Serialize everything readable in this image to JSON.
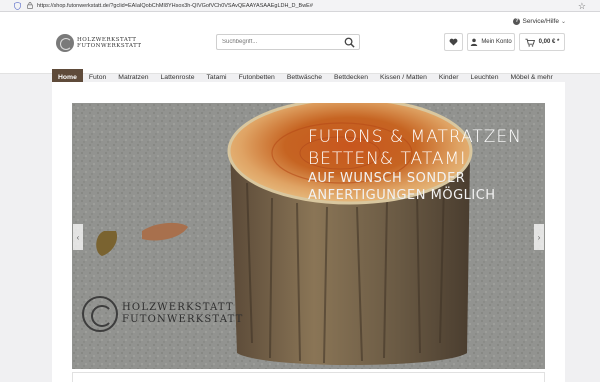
{
  "browser": {
    "url": "https://shop.futonwerkstatt.de/?gclid=EAIaIQobChMI8YHsox3h-QIVGofVCh0VSAvQEAAYASAAEgLDH_D_BwE#"
  },
  "header": {
    "service_label": "Service/Hilfe",
    "logo_line1": "HOLZWERKSTATT",
    "logo_line2": "FUTONWERKSTATT",
    "search_placeholder": "Suchbegriff...",
    "account_label": "Mein Konto",
    "cart_total": "0,00 € *"
  },
  "nav": {
    "items": [
      {
        "label": "Home",
        "active": true
      },
      {
        "label": "Futon"
      },
      {
        "label": "Matratzen"
      },
      {
        "label": "Lattenroste"
      },
      {
        "label": "Tatami"
      },
      {
        "label": "Futonbetten"
      },
      {
        "label": "Bettwäsche"
      },
      {
        "label": "Bettdecken"
      },
      {
        "label": "Kissen / Matten"
      },
      {
        "label": "Kinder"
      },
      {
        "label": "Leuchten"
      },
      {
        "label": "Möbel & mehr"
      }
    ]
  },
  "hero": {
    "line1": "FUTONS & MATRATZEN",
    "line2": "BETTEN& TATAMI",
    "line3": "AUF WUNSCH SONDER",
    "line4": "ANFERTIGUNGEN MÖGLICH",
    "logo_line1": "HOLZWERKSTATT",
    "logo_line2": "FUTONWERKSTATT",
    "prev_arrow": "‹",
    "next_arrow": "›"
  },
  "icons": {
    "shield": "shield-icon",
    "lock": "lock-icon",
    "star": "bookmark-star-icon",
    "help": "help-icon",
    "search": "search-icon",
    "heart": "heart-icon",
    "user": "user-icon",
    "cart": "cart-icon"
  },
  "colors": {
    "nav_active": "#5f4b3a",
    "page_bg": "#f0f0f2"
  }
}
